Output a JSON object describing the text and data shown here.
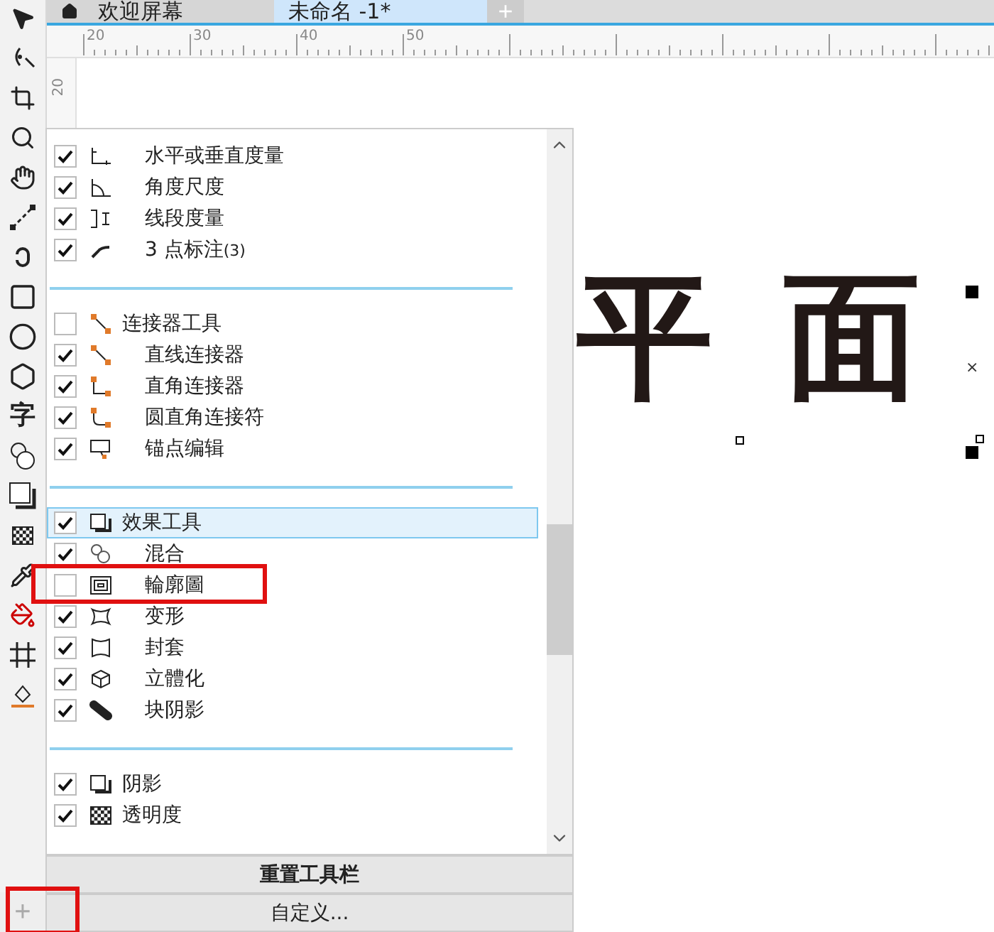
{
  "tabs": [
    {
      "label": "欢迎屏幕",
      "kind": "home",
      "selected": false
    },
    {
      "label": "未命名 -1*",
      "kind": "doc",
      "selected": true
    }
  ],
  "new_tab": "+",
  "toolbar": {
    "text_tool": "字",
    "add_button": "+"
  },
  "ruler": {
    "top_labels": [
      "20",
      "30",
      "40",
      "50"
    ],
    "left_labels": [
      "20"
    ]
  },
  "canvas": {
    "glyphs": [
      "平",
      "面"
    ],
    "center_mark": "×"
  },
  "panel": {
    "sections": [
      {
        "rows": [
          {
            "kind": "item",
            "label": "水平或垂直度量",
            "checked": true,
            "selected": false
          },
          {
            "kind": "item",
            "label": "角度尺度",
            "checked": true,
            "selected": false
          },
          {
            "kind": "item",
            "label": "线段度量",
            "checked": true,
            "selected": false
          },
          {
            "kind": "item",
            "label": "3 点标注",
            "suffix": "(3)",
            "checked": true,
            "selected": false
          }
        ]
      },
      {
        "rows": [
          {
            "kind": "group",
            "label": "连接器工具",
            "checked": false,
            "selected": false
          },
          {
            "kind": "item",
            "label": "直线连接器",
            "checked": true,
            "selected": false
          },
          {
            "kind": "item",
            "label": "直角连接器",
            "checked": true,
            "selected": false
          },
          {
            "kind": "item",
            "label": "圆直角连接符",
            "checked": true,
            "selected": false
          },
          {
            "kind": "item",
            "label": "锚点编辑",
            "checked": true,
            "selected": false
          }
        ]
      },
      {
        "rows": [
          {
            "kind": "group",
            "label": "效果工具",
            "checked": true,
            "selected": true
          },
          {
            "kind": "item",
            "label": "混合",
            "checked": true,
            "selected": false
          },
          {
            "kind": "item",
            "label": "輪廓圖",
            "checked": false,
            "selected": false
          },
          {
            "kind": "item",
            "label": "变形",
            "checked": true,
            "selected": false
          },
          {
            "kind": "item",
            "label": "封套",
            "checked": true,
            "selected": false
          },
          {
            "kind": "item",
            "label": "立體化",
            "checked": true,
            "selected": false
          },
          {
            "kind": "item",
            "label": "块阴影",
            "checked": true,
            "selected": false
          }
        ]
      },
      {
        "rows": [
          {
            "kind": "group",
            "label": "阴影",
            "checked": true,
            "selected": false
          },
          {
            "kind": "group",
            "label": "透明度",
            "checked": true,
            "selected": false
          }
        ]
      }
    ],
    "buttons": [
      "重置工具栏",
      "自定义..."
    ]
  }
}
